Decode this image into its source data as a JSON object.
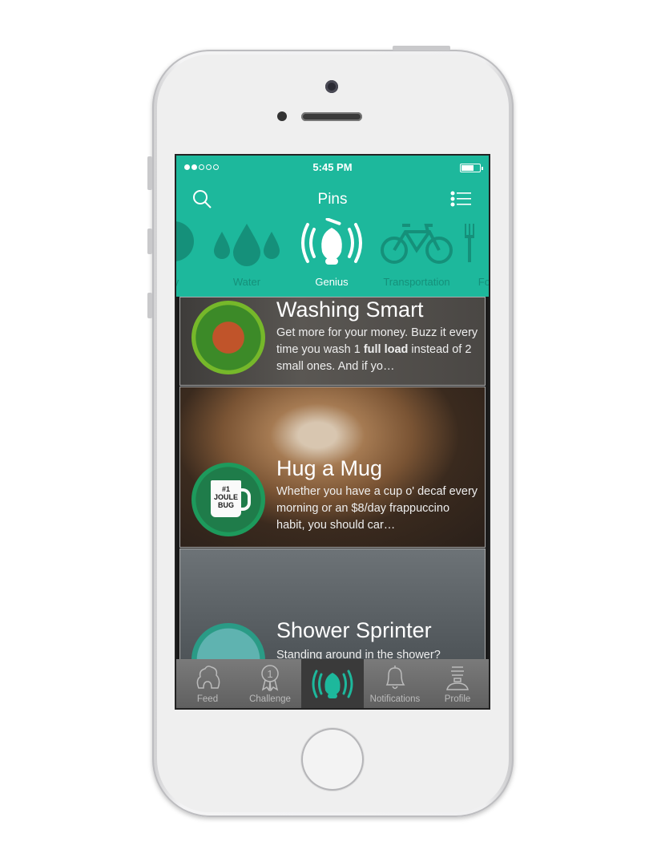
{
  "status_bar": {
    "time": "5:45 PM",
    "signal_bars_filled": 2,
    "signal_bars_total": 5,
    "battery_level": 0.6
  },
  "nav": {
    "title": "Pins",
    "left_icon": "search-icon",
    "right_icon": "list-icon"
  },
  "categories": [
    {
      "label": "y",
      "icon": "circle-icon"
    },
    {
      "label": "Water",
      "icon": "water-drops-icon"
    },
    {
      "label": "Genius",
      "icon": "genius-bug-icon",
      "active": true
    },
    {
      "label": "Transportation",
      "icon": "bicycle-icon"
    },
    {
      "label": "Foo",
      "icon": "fork-icon"
    }
  ],
  "cards": [
    {
      "title": "Washing Smart",
      "text_before": "Get more for your money. Buzz it every time you wash 1 ",
      "text_bold": "full load",
      "text_after": " instead of 2 small ones. And if yo…",
      "badge": "laundry-basket-icon"
    },
    {
      "title": "Hug a Mug",
      "text": "Whether you have a cup o' decaf every morning or an $8/day frappuccino habit, you should car…",
      "badge": "mug-icon",
      "badge_text": "#1 JOULE BUG"
    },
    {
      "title": "Shower Sprinter",
      "text": "Standing around in the shower?",
      "badge": "shower-person-icon"
    }
  ],
  "tabs": [
    {
      "label": "Feed",
      "icon": "hive-icon"
    },
    {
      "label": "Challenge",
      "icon": "ribbon-icon"
    },
    {
      "label": "",
      "icon": "genius-bug-icon",
      "active": true
    },
    {
      "label": "Notifications",
      "icon": "bell-icon"
    },
    {
      "label": "Profile",
      "icon": "bulb-person-icon"
    }
  ],
  "colors": {
    "accent": "#1db89c",
    "inactive_category": "#15907a"
  }
}
